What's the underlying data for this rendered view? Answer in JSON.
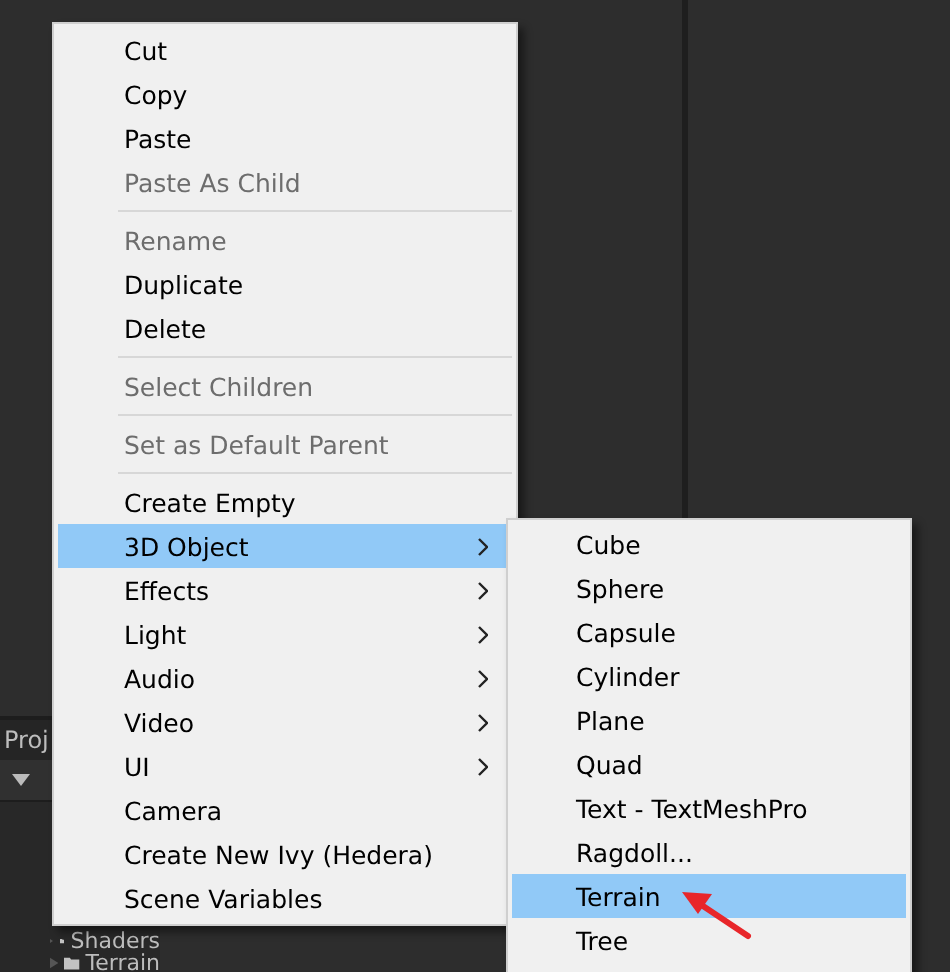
{
  "project_panel": {
    "tab": "Proj",
    "folders": [
      {
        "name": "Shaders"
      },
      {
        "name": "Terrain"
      }
    ]
  },
  "context_menu": {
    "items": [
      {
        "kind": "item",
        "label": "Cut",
        "disabled": false,
        "selected": false,
        "submenu": false
      },
      {
        "kind": "item",
        "label": "Copy",
        "disabled": false,
        "selected": false,
        "submenu": false
      },
      {
        "kind": "item",
        "label": "Paste",
        "disabled": false,
        "selected": false,
        "submenu": false
      },
      {
        "kind": "item",
        "label": "Paste As Child",
        "disabled": true,
        "selected": false,
        "submenu": false
      },
      {
        "kind": "separator"
      },
      {
        "kind": "item",
        "label": "Rename",
        "disabled": true,
        "selected": false,
        "submenu": false
      },
      {
        "kind": "item",
        "label": "Duplicate",
        "disabled": false,
        "selected": false,
        "submenu": false
      },
      {
        "kind": "item",
        "label": "Delete",
        "disabled": false,
        "selected": false,
        "submenu": false
      },
      {
        "kind": "separator"
      },
      {
        "kind": "item",
        "label": "Select Children",
        "disabled": true,
        "selected": false,
        "submenu": false
      },
      {
        "kind": "separator"
      },
      {
        "kind": "item",
        "label": "Set as Default Parent",
        "disabled": true,
        "selected": false,
        "submenu": false
      },
      {
        "kind": "separator"
      },
      {
        "kind": "item",
        "label": "Create Empty",
        "disabled": false,
        "selected": false,
        "submenu": false
      },
      {
        "kind": "item",
        "label": "3D Object",
        "disabled": false,
        "selected": true,
        "submenu": true
      },
      {
        "kind": "item",
        "label": "Effects",
        "disabled": false,
        "selected": false,
        "submenu": true
      },
      {
        "kind": "item",
        "label": "Light",
        "disabled": false,
        "selected": false,
        "submenu": true
      },
      {
        "kind": "item",
        "label": "Audio",
        "disabled": false,
        "selected": false,
        "submenu": true
      },
      {
        "kind": "item",
        "label": "Video",
        "disabled": false,
        "selected": false,
        "submenu": true
      },
      {
        "kind": "item",
        "label": "UI",
        "disabled": false,
        "selected": false,
        "submenu": true
      },
      {
        "kind": "item",
        "label": "Camera",
        "disabled": false,
        "selected": false,
        "submenu": false
      },
      {
        "kind": "item",
        "label": "Create New Ivy (Hedera)",
        "disabled": false,
        "selected": false,
        "submenu": false
      },
      {
        "kind": "item",
        "label": "Scene Variables",
        "disabled": false,
        "selected": false,
        "submenu": false
      }
    ]
  },
  "submenu": {
    "items": [
      {
        "label": "Cube",
        "selected": false
      },
      {
        "label": "Sphere",
        "selected": false
      },
      {
        "label": "Capsule",
        "selected": false
      },
      {
        "label": "Cylinder",
        "selected": false
      },
      {
        "label": "Plane",
        "selected": false
      },
      {
        "label": "Quad",
        "selected": false
      },
      {
        "label": "Text - TextMeshPro",
        "selected": false
      },
      {
        "label": "Ragdoll...",
        "selected": false
      },
      {
        "label": "Terrain",
        "selected": true
      },
      {
        "label": "Tree",
        "selected": false
      }
    ]
  }
}
